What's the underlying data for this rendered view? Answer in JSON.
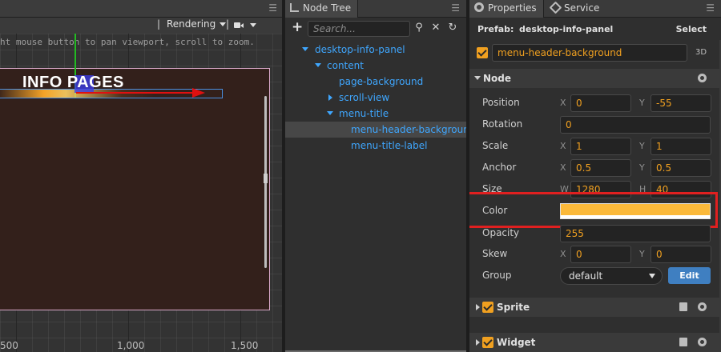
{
  "scene": {
    "menu_icon": "hamburger-icon",
    "toolbar": {
      "separator": "|",
      "rendering_label": "Rendering",
      "camera_icon": "video-camera-icon"
    },
    "hint": "ht mouse button to pan viewport, scroll to zoom.",
    "canvas_title_a": "INFO P",
    "canvas_title_b": "AGES",
    "ruler": [
      "500",
      "1,000",
      "1,500"
    ]
  },
  "node_tree": {
    "tab_label": "Node Tree",
    "search_placeholder": "Search...",
    "items": [
      {
        "label": "desktop-info-panel",
        "arrow": "down",
        "depth": 1
      },
      {
        "label": "content",
        "arrow": "down",
        "depth": 2
      },
      {
        "label": "page-background",
        "arrow": "none",
        "depth": 3
      },
      {
        "label": "scroll-view",
        "arrow": "right",
        "depth": 3
      },
      {
        "label": "menu-title",
        "arrow": "down",
        "depth": 3
      },
      {
        "label": "menu-header-background",
        "arrow": "none",
        "depth": 4,
        "selected": true
      },
      {
        "label": "menu-title-label",
        "arrow": "none",
        "depth": 4
      }
    ]
  },
  "properties": {
    "tabs": [
      {
        "label": "Properties",
        "icon": "gear-icon"
      },
      {
        "label": "Service",
        "icon": "service-icon"
      }
    ],
    "prefab_label": "Prefab:",
    "prefab_name": "desktop-info-panel",
    "prefab_select": "Select",
    "node_name": "menu-header-background",
    "tag_3d": "3D",
    "node_section": "Node",
    "rows": {
      "position": {
        "label": "Position",
        "x_axis": "X",
        "x": "0",
        "y_axis": "Y",
        "y": "-55"
      },
      "rotation": {
        "label": "Rotation",
        "value": "0"
      },
      "scale": {
        "label": "Scale",
        "x_axis": "X",
        "x": "1",
        "y_axis": "Y",
        "y": "1"
      },
      "anchor": {
        "label": "Anchor",
        "x_axis": "X",
        "x": "0.5",
        "y_axis": "Y",
        "y": "0.5"
      },
      "size": {
        "label": "Size",
        "w_axis": "W",
        "w": "1280",
        "h_axis": "H",
        "h": "40"
      },
      "color": {
        "label": "Color",
        "value": "#FBB93A"
      },
      "opacity": {
        "label": "Opacity",
        "value": "255"
      },
      "skew": {
        "label": "Skew",
        "x_axis": "X",
        "x": "0",
        "y_axis": "Y",
        "y": "0"
      },
      "group": {
        "label": "Group",
        "value": "default",
        "edit": "Edit"
      }
    },
    "components": [
      {
        "label": "Sprite"
      },
      {
        "label": "Widget"
      }
    ]
  },
  "colors": {
    "accent_orange": "#F0A020",
    "tree_blue": "#3FA7FF",
    "edit_button": "#3F7FC1",
    "highlight_red": "#E02020",
    "scene_canvas": "#33201B"
  }
}
